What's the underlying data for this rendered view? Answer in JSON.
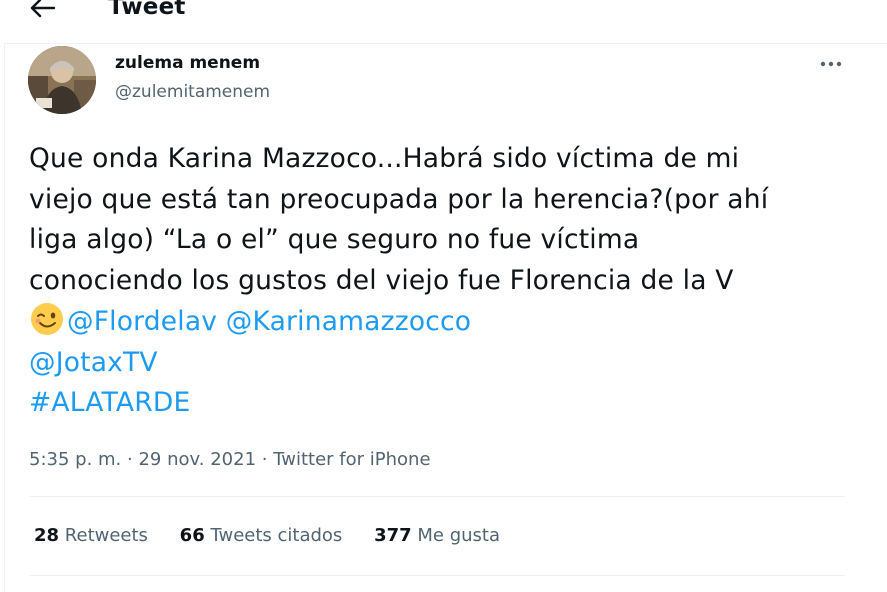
{
  "header": {
    "title": "Tweet",
    "back_icon": "arrow-left-icon"
  },
  "author": {
    "name": "zulema menem",
    "handle": "@zulemitamenem",
    "avatar_icon": "profile-photo"
  },
  "more_icon": "more-horizontal-icon",
  "tweet": {
    "line1": "Que onda Karina Mazzoco...Habrá sido víctima de mi",
    "line2": "viejo que está tan preocupada por la herencia?(por ahí",
    "line3": "liga algo) “La o el” que  seguro no fue víctima",
    "line4": "conociendo los gustos del viejo fue Florencia de la V",
    "emoji": "winking-face-emoji",
    "mention1": "@Flordelav",
    "mention2": "@Karinamazzocco",
    "mention3": "@JotaxTV",
    "hashtag": "#ALATARDE"
  },
  "meta": {
    "time": "5:35 p. m.",
    "sep": "·",
    "date": "29 nov. 2021",
    "source": "Twitter for iPhone"
  },
  "stats": {
    "retweets_count": "28",
    "retweets_label": "Retweets",
    "quotes_count": "66",
    "quotes_label": "Tweets citados",
    "likes_count": "377",
    "likes_label": "Me gusta"
  },
  "colors": {
    "link": "#1d9bf0",
    "text": "#0f1419",
    "secondary": "#536471",
    "divider": "#eff3f4"
  }
}
